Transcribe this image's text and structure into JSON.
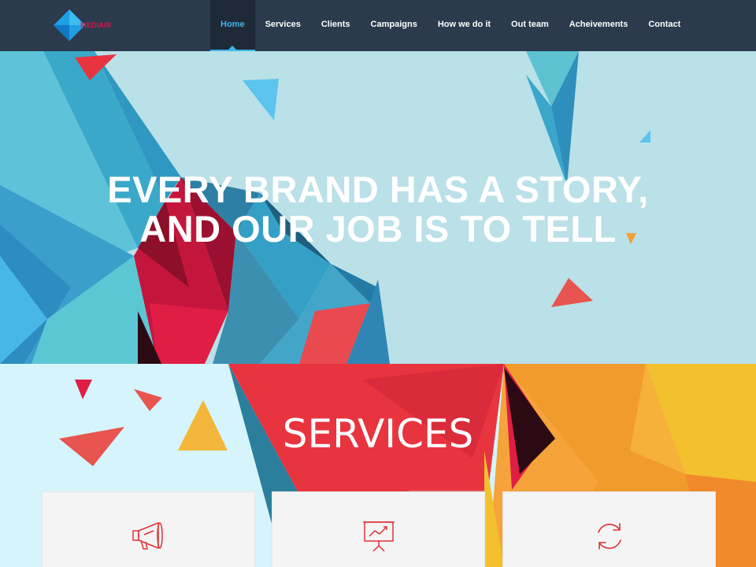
{
  "brand": {
    "name": "MEDIAIR",
    "logo_icon": "diamond-logo-icon"
  },
  "nav": {
    "items": [
      {
        "label": "Home",
        "active": true
      },
      {
        "label": "Services"
      },
      {
        "label": "Clients"
      },
      {
        "label": "Campaigns"
      },
      {
        "label": "How we do it"
      },
      {
        "label": "Out team"
      },
      {
        "label": "Acheivements"
      },
      {
        "label": "Contact"
      }
    ]
  },
  "hero": {
    "line1": "EVERY BRAND HAS A STORY,",
    "line2": "AND OUR JOB IS TO TELL"
  },
  "services": {
    "title": "SERVICES",
    "cards": [
      {
        "icon": "megaphone-icon"
      },
      {
        "icon": "presentation-chart-icon"
      },
      {
        "icon": "refresh-icon"
      }
    ]
  },
  "colors": {
    "nav_bg": "#2b3a4c",
    "accent": "#3fb6e8",
    "icon_red": "#e0313a",
    "brand_pink": "#e0144b"
  }
}
